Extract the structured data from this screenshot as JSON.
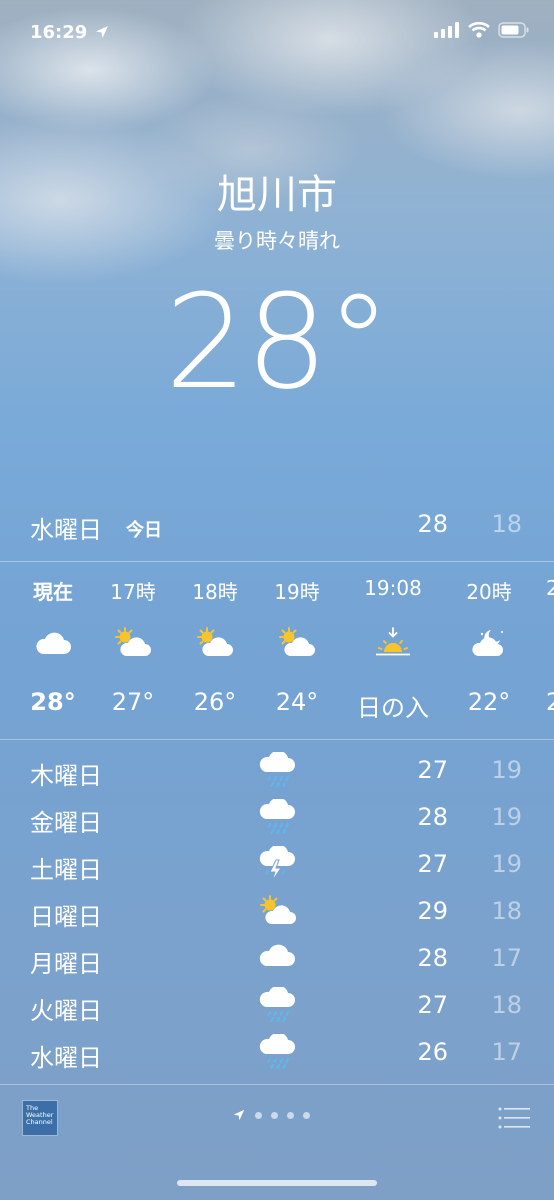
{
  "status_bar": {
    "time": "16:29"
  },
  "location": {
    "city": "旭川市",
    "condition": "曇り時々晴れ",
    "temperature": "28°"
  },
  "today": {
    "day": "水曜日",
    "label": "今日",
    "high": "28",
    "low": "18"
  },
  "hourly": [
    {
      "label": "現在",
      "icon": "cloud-icon",
      "temp": "28°"
    },
    {
      "label": "17時",
      "icon": "partly-sunny-icon",
      "temp": "27°"
    },
    {
      "label": "18時",
      "icon": "partly-sunny-icon",
      "temp": "26°"
    },
    {
      "label": "19時",
      "icon": "partly-sunny-icon",
      "temp": "24°"
    },
    {
      "label": "19:08",
      "icon": "sunset-icon",
      "temp": "日の入"
    },
    {
      "label": "20時",
      "icon": "partly-cloudy-night-icon",
      "temp": "22°"
    },
    {
      "label": "2",
      "icon": "cloud-icon",
      "temp": "2"
    }
  ],
  "daily": [
    {
      "day": "木曜日",
      "icon": "rain-icon",
      "high": "27",
      "low": "19"
    },
    {
      "day": "金曜日",
      "icon": "rain-icon",
      "high": "28",
      "low": "19"
    },
    {
      "day": "土曜日",
      "icon": "thunderstorm-icon",
      "high": "27",
      "low": "19"
    },
    {
      "day": "日曜日",
      "icon": "partly-sunny-icon",
      "high": "29",
      "low": "18"
    },
    {
      "day": "月曜日",
      "icon": "cloud-icon",
      "high": "28",
      "low": "17"
    },
    {
      "day": "火曜日",
      "icon": "rain-icon",
      "high": "27",
      "low": "18"
    },
    {
      "day": "水曜日",
      "icon": "rain-icon",
      "high": "26",
      "low": "17"
    }
  ],
  "footer": {
    "twc_logo": "The Weather Channel"
  },
  "colors": {
    "sun": "#f7c52b",
    "rain": "#5db8f0"
  }
}
